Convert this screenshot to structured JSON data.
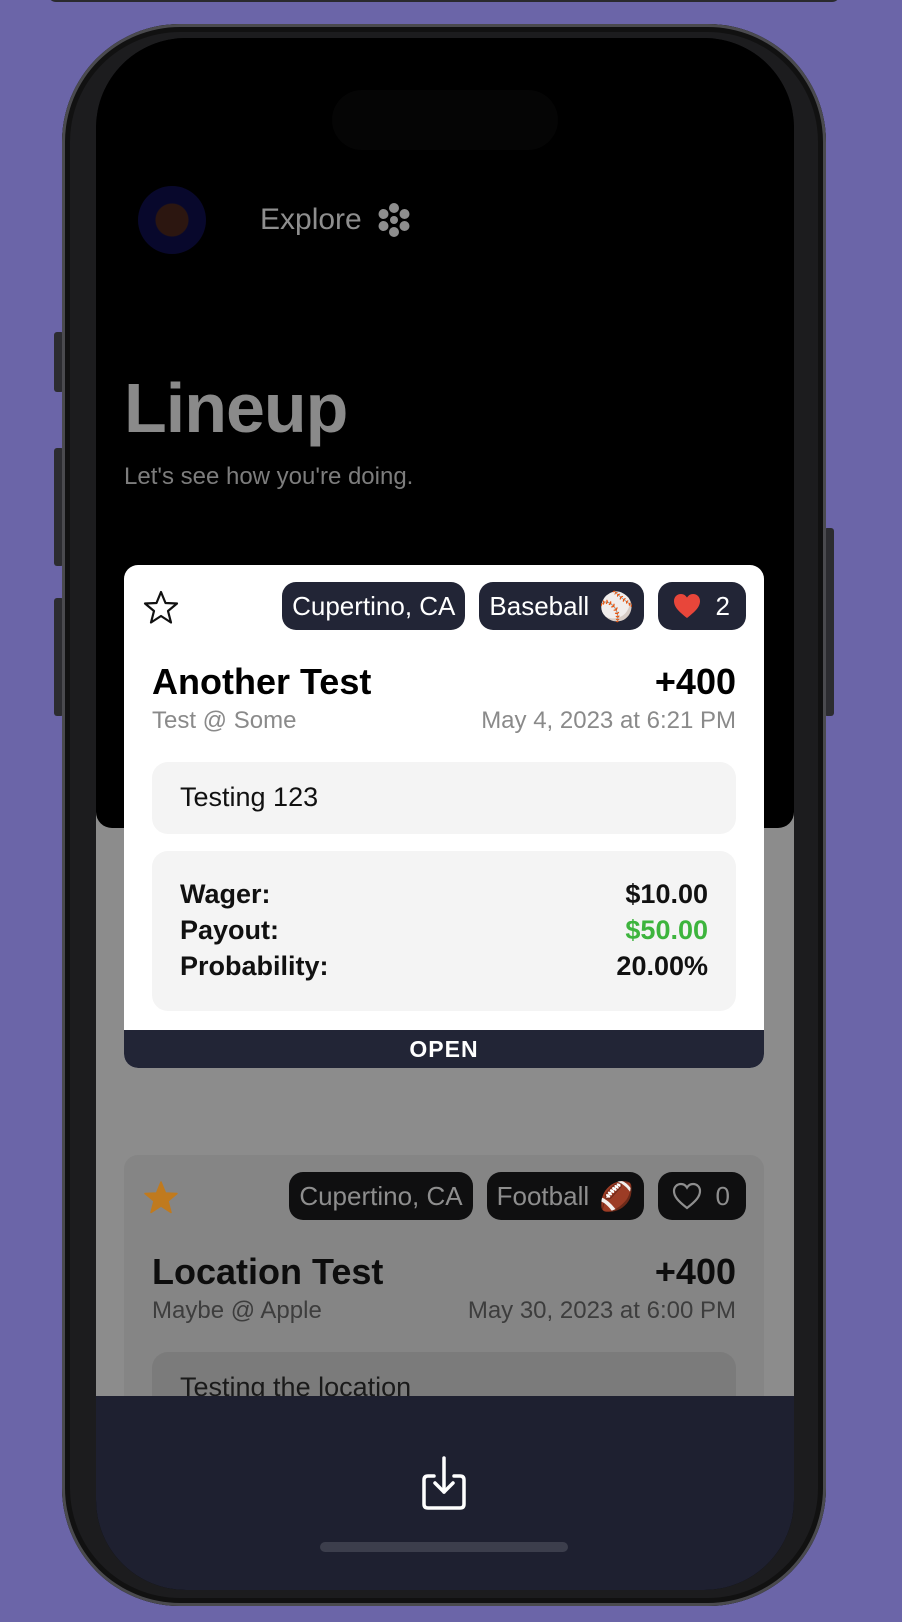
{
  "header": {
    "explore_label": "Explore",
    "title": "Lineup",
    "subtitle": "Let's see how you're doing."
  },
  "cards": [
    {
      "favorite": false,
      "location": "Cupertino, CA",
      "sport": "Baseball",
      "sport_emoji": "⚾",
      "likes": "2",
      "liked": true,
      "title": "Another Test",
      "odds": "+400",
      "matchup": "Test @ Some",
      "date": "May 4, 2023 at 6:21 PM",
      "description": "Testing 123",
      "stats": {
        "wager_label": "Wager:",
        "wager": "$10.00",
        "payout_label": "Payout:",
        "payout": "$50.00",
        "probability_label": "Probability:",
        "probability": "20.00%"
      },
      "status": "OPEN"
    },
    {
      "favorite": true,
      "location": "Cupertino, CA",
      "sport": "Football",
      "sport_emoji": "🏈",
      "likes": "0",
      "liked": false,
      "title": "Location Test",
      "odds": "+400",
      "matchup": "Maybe @ Apple",
      "date": "May 30, 2023 at 6:00 PM",
      "description": "Testing the location"
    }
  ],
  "colors": {
    "background": "#6b65a8",
    "chip": "#222536",
    "payout_green": "#3db43d",
    "favorite_star": "#c07a1e",
    "heart": "#e8463a"
  },
  "icons": {
    "explore": "flower-dots-icon",
    "favorite": "star-icon",
    "like": "heart-icon",
    "share": "download-share-icon"
  }
}
